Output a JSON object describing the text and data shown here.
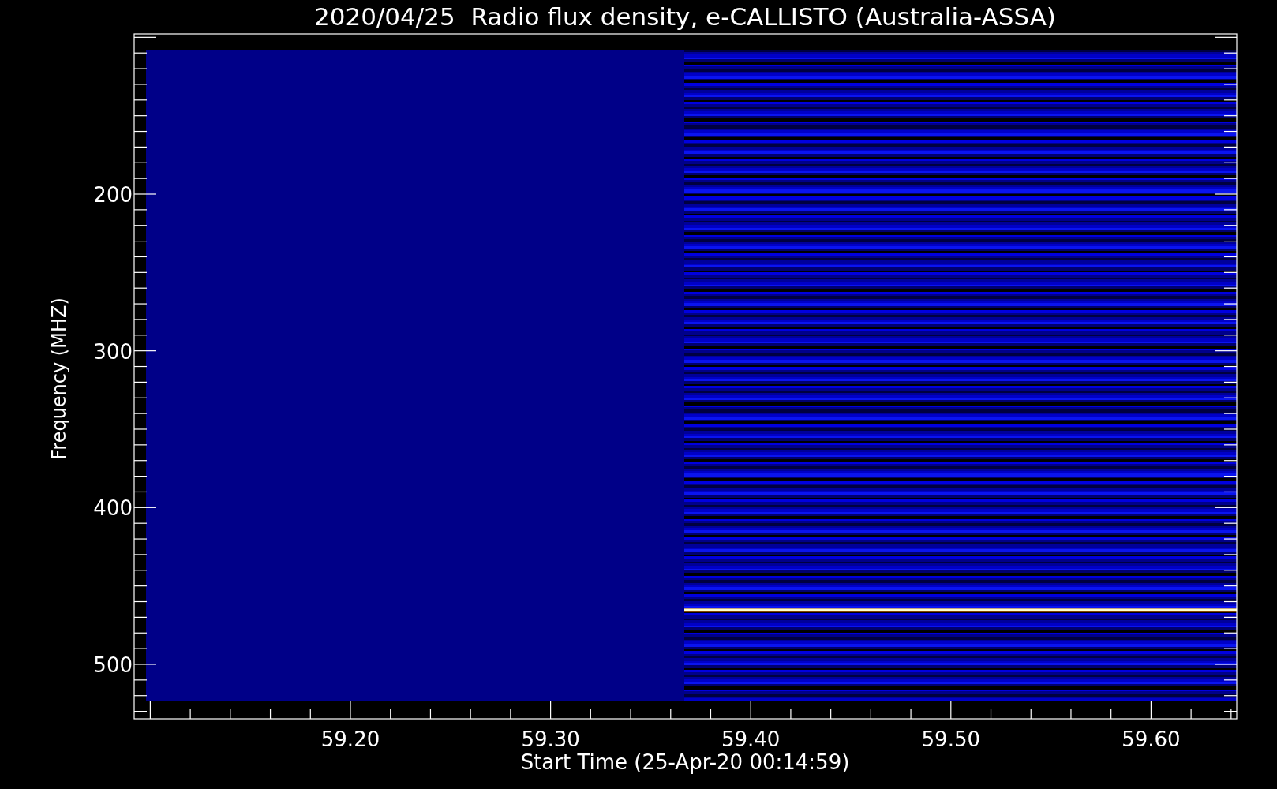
{
  "title": "2020/04/25  Radio flux density, e-CALLISTO (Australia-ASSA)",
  "plot": {
    "ylabel": "Frequency (MHZ)",
    "xlabel": "Start Time (25-Apr-20 00:14:59)",
    "yticks": [
      "200",
      "300",
      "400",
      "500"
    ],
    "xticks": [
      "59.20",
      "59.30",
      "59.40",
      "59.50",
      "59.60"
    ]
  }
}
